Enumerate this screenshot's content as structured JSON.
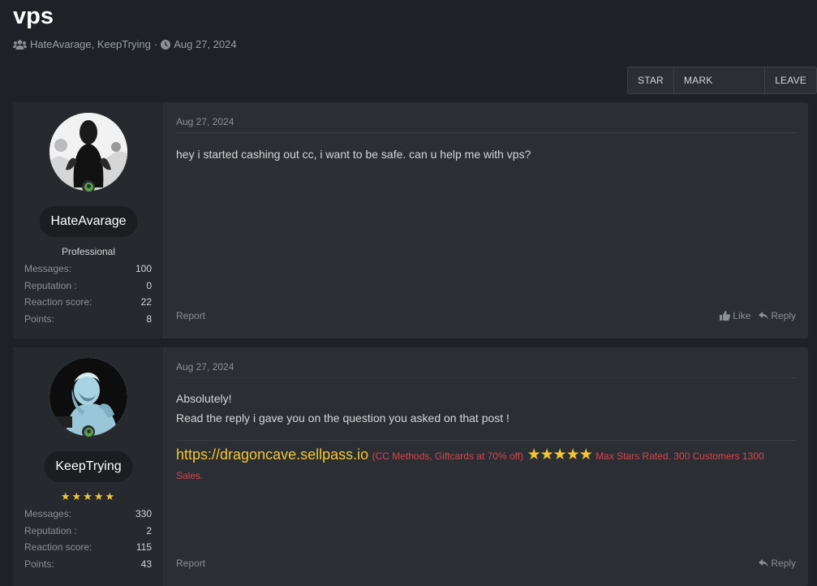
{
  "thread": {
    "title": "vps",
    "participants": "HateAvarage, KeepTrying",
    "separator": "·",
    "date": "Aug 27, 2024"
  },
  "actions": [
    {
      "label": "STAR"
    },
    {
      "label": "MARK UNREAD"
    },
    {
      "label": "LEAVE"
    }
  ],
  "posts": [
    {
      "username": "HateAvarage",
      "user_title": "Professional",
      "stats": [
        {
          "label": "Messages:",
          "value": "100"
        },
        {
          "label": "Reputation :",
          "value": "0"
        },
        {
          "label": "Reaction score:",
          "value": "22"
        },
        {
          "label": "Points:",
          "value": "8"
        }
      ],
      "date": "Aug 27, 2024",
      "body_lines": [
        "hey i started cashing out cc, i want to be safe. can u help me with vps?"
      ],
      "report": "Report",
      "like": "Like",
      "reply": "Reply"
    },
    {
      "username": "KeepTrying",
      "user_stars": "★★★★★",
      "stats": [
        {
          "label": "Messages:",
          "value": "330"
        },
        {
          "label": "Reputation :",
          "value": "2"
        },
        {
          "label": "Reaction score:",
          "value": "115"
        },
        {
          "label": "Points:",
          "value": "43"
        }
      ],
      "date": "Aug 27, 2024",
      "body_lines": [
        "Absolutely!",
        "Read the reply i gave you on the question you asked on that post !"
      ],
      "signature": {
        "link": "https://dragoncave.sellpass.io",
        "paren": "(CC Methods, Giftcards at 70% off)",
        "stars": "★★★★★",
        "tail": "Max Stars Rated. 300 Customers 1300 Sales."
      },
      "report": "Report",
      "reply": "Reply"
    }
  ],
  "colors": {
    "background": "#1e2226",
    "panel": "#2b2f33",
    "accent_gold": "#f4c535",
    "signature_red": "#d9424f",
    "online_green": "#5aa14a"
  }
}
